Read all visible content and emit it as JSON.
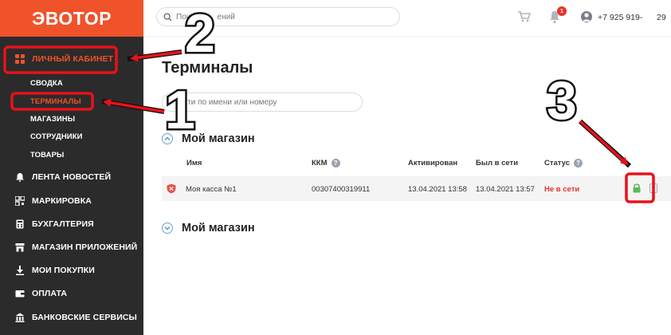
{
  "app": {
    "logo": "ЭВОТОР"
  },
  "sidebar": {
    "items": [
      {
        "label": "ЛИЧНЫЙ КАБИНЕТ",
        "icon": "grid-icon",
        "active": true
      },
      {
        "label": "ЛЕНТА НОВОСТЕЙ",
        "icon": "bell-icon"
      },
      {
        "label": "МАРКИРОВКА",
        "icon": "qr-icon"
      },
      {
        "label": "БУХГАЛТЕРИЯ",
        "icon": "calculator-icon"
      },
      {
        "label": "МАГАЗИН ПРИЛОЖЕНИЙ",
        "icon": "store-icon"
      },
      {
        "label": "МОИ ПОКУПКИ",
        "icon": "download-icon"
      },
      {
        "label": "ОПЛАТА",
        "icon": "wallet-icon"
      },
      {
        "label": "БАНКОВСКИЕ СЕРВИСЫ",
        "icon": "bank-icon"
      }
    ],
    "subitems": [
      "СВОДКА",
      "ТЕРМИНАЛЫ",
      "МАГАЗИНЫ",
      "СОТРУДНИКИ",
      "ТОВАРЫ"
    ]
  },
  "topbar": {
    "search_placeholder": "Пои            ений",
    "notification_count": "1",
    "phone": "+7 925 919-",
    "extra": "29"
  },
  "main": {
    "title": "Терминалы",
    "search_placeholder": "айти по имени или номеру",
    "sections": [
      "Мой магазин",
      "Мой магазин"
    ],
    "columns": {
      "name": "Имя",
      "kkm": "ККМ",
      "activated": "Активирован",
      "online": "Был в сети",
      "status": "Статус"
    },
    "rows": [
      {
        "name": "Моя касса №1",
        "kkm": "00307400319911",
        "activated": "13.04.2021 13:58",
        "online": "13.04.2021 13:57",
        "status": "Не в сети"
      }
    ]
  },
  "annotations": {
    "step1": "1",
    "step2": "2",
    "step3": "3"
  },
  "colors": {
    "brand": "#f0522a",
    "sidebar": "#2b2b2b",
    "annotation": "#e8121a",
    "status_offline": "#e8332f",
    "lock": "#5cb85c"
  }
}
